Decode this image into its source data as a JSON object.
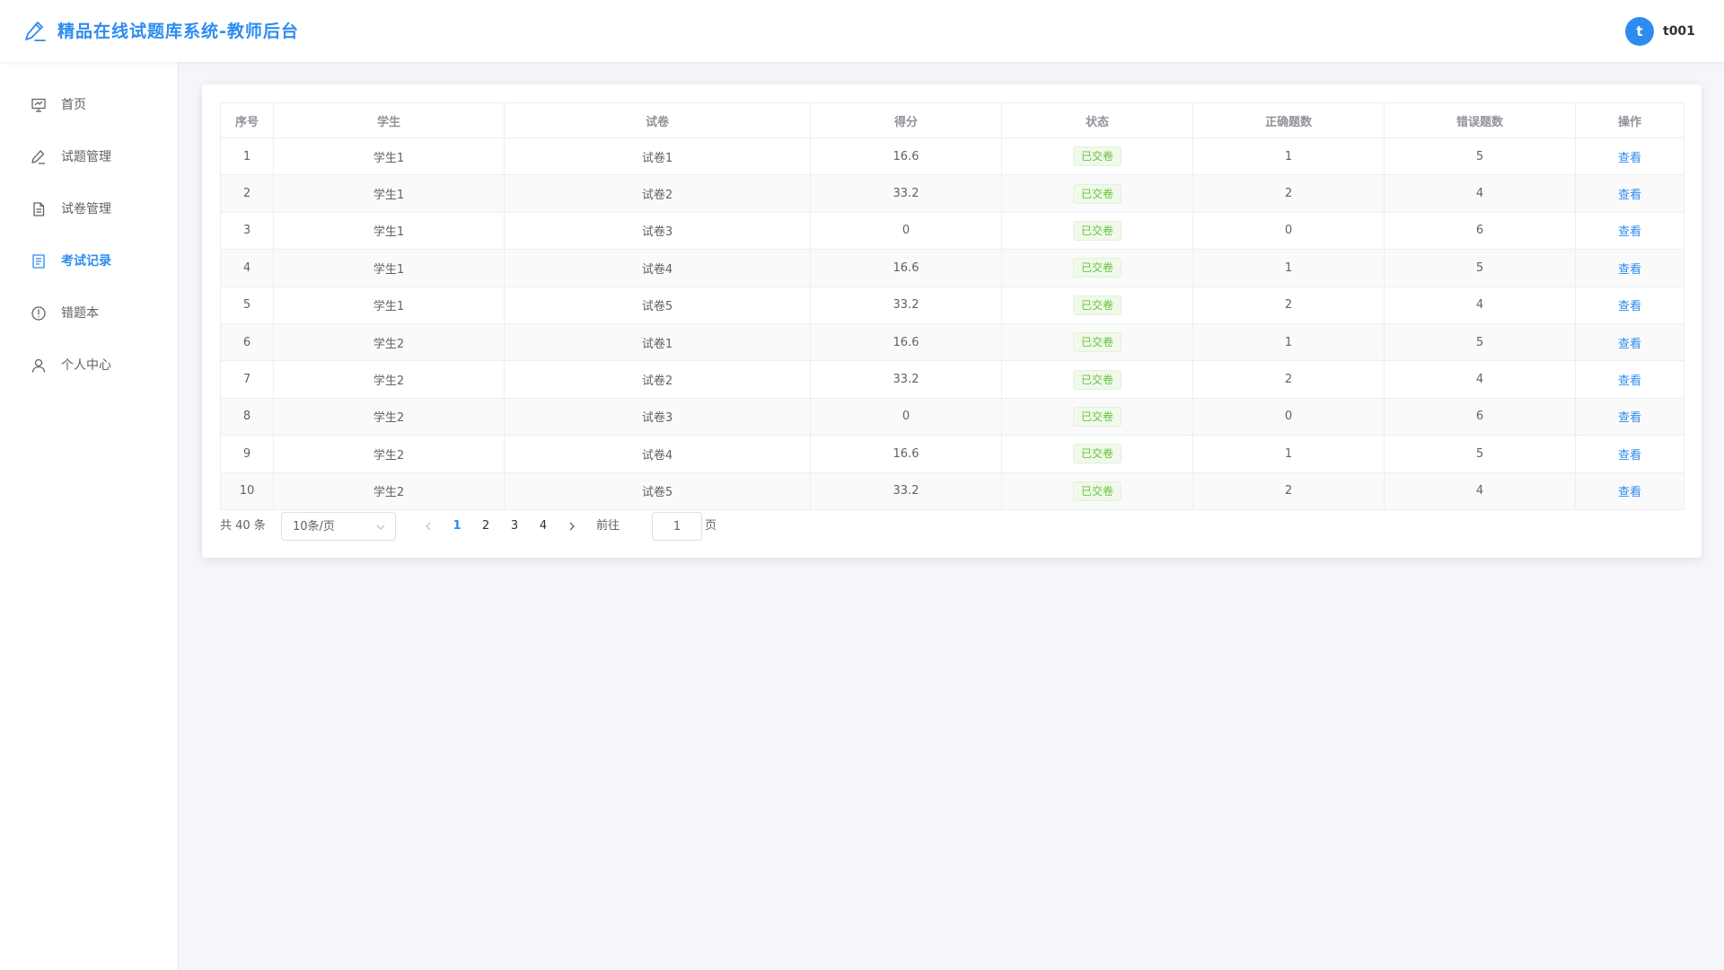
{
  "app": {
    "title": "精品在线试题库系统-教师后台"
  },
  "user": {
    "avatar_letter": "t",
    "name": "t001"
  },
  "sidebar": {
    "items": [
      {
        "label": "首页",
        "icon": "presentation-icon"
      },
      {
        "label": "试题管理",
        "icon": "edit-icon"
      },
      {
        "label": "试卷管理",
        "icon": "document-icon"
      },
      {
        "label": "考试记录",
        "icon": "list-document-icon",
        "active": true
      },
      {
        "label": "错题本",
        "icon": "warning-circle-icon"
      },
      {
        "label": "个人中心",
        "icon": "user-icon"
      }
    ]
  },
  "table": {
    "headers": [
      "序号",
      "学生",
      "试卷",
      "得分",
      "状态",
      "正确题数",
      "错误题数",
      "操作"
    ],
    "rows": [
      {
        "index": "1",
        "student": "学生1",
        "paper": "试卷1",
        "score": "16.6",
        "status": "已交卷",
        "correct": "1",
        "wrong": "5",
        "action": "查看"
      },
      {
        "index": "2",
        "student": "学生1",
        "paper": "试卷2",
        "score": "33.2",
        "status": "已交卷",
        "correct": "2",
        "wrong": "4",
        "action": "查看"
      },
      {
        "index": "3",
        "student": "学生1",
        "paper": "试卷3",
        "score": "0",
        "status": "已交卷",
        "correct": "0",
        "wrong": "6",
        "action": "查看"
      },
      {
        "index": "4",
        "student": "学生1",
        "paper": "试卷4",
        "score": "16.6",
        "status": "已交卷",
        "correct": "1",
        "wrong": "5",
        "action": "查看"
      },
      {
        "index": "5",
        "student": "学生1",
        "paper": "试卷5",
        "score": "33.2",
        "status": "已交卷",
        "correct": "2",
        "wrong": "4",
        "action": "查看"
      },
      {
        "index": "6",
        "student": "学生2",
        "paper": "试卷1",
        "score": "16.6",
        "status": "已交卷",
        "correct": "1",
        "wrong": "5",
        "action": "查看"
      },
      {
        "index": "7",
        "student": "学生2",
        "paper": "试卷2",
        "score": "33.2",
        "status": "已交卷",
        "correct": "2",
        "wrong": "4",
        "action": "查看"
      },
      {
        "index": "8",
        "student": "学生2",
        "paper": "试卷3",
        "score": "0",
        "status": "已交卷",
        "correct": "0",
        "wrong": "6",
        "action": "查看"
      },
      {
        "index": "9",
        "student": "学生2",
        "paper": "试卷4",
        "score": "16.6",
        "status": "已交卷",
        "correct": "1",
        "wrong": "5",
        "action": "查看"
      },
      {
        "index": "10",
        "student": "学生2",
        "paper": "试卷5",
        "score": "33.2",
        "status": "已交卷",
        "correct": "2",
        "wrong": "4",
        "action": "查看"
      }
    ]
  },
  "pagination": {
    "total_text": "共 40 条",
    "page_size": "10条/页",
    "pages": [
      "1",
      "2",
      "3",
      "4"
    ],
    "current_page": "1",
    "goto_label": "前往",
    "goto_value": "1",
    "page_unit": "页"
  },
  "colors": {
    "accent": "#2d8cf0",
    "status_green": "#67c23a",
    "background": "#f5f6fa"
  }
}
